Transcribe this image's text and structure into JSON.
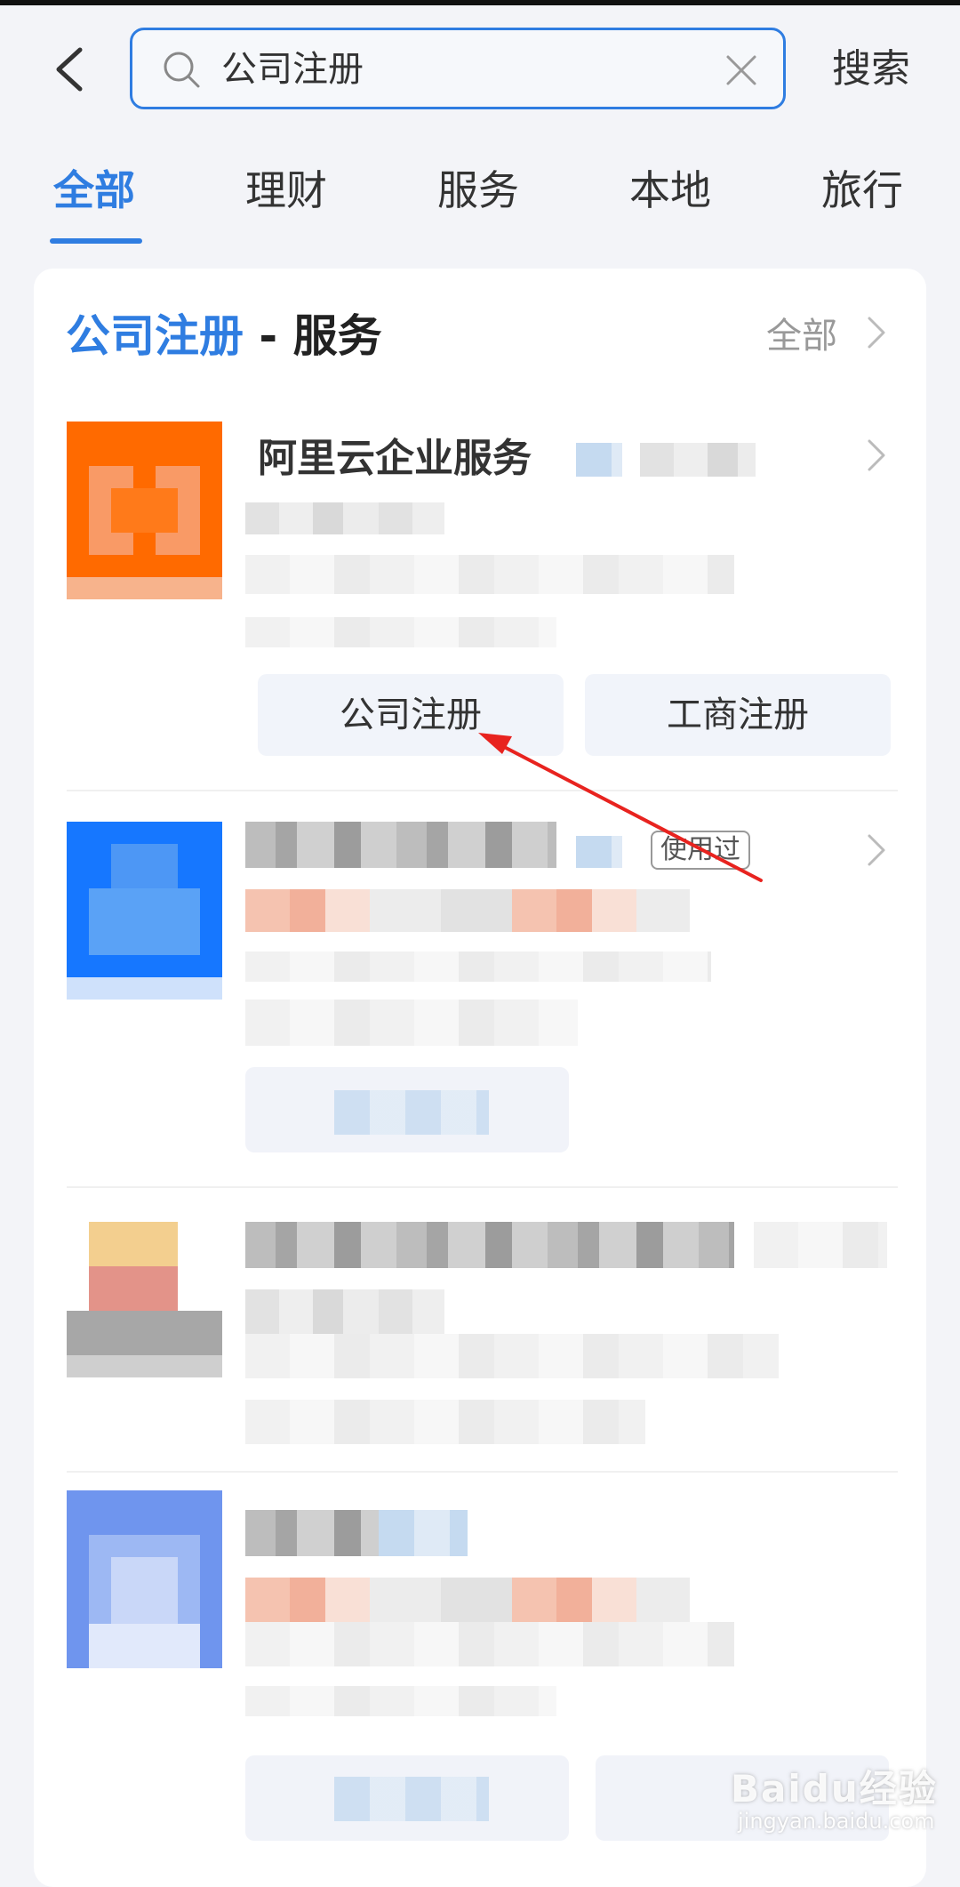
{
  "search": {
    "query": "公司注册",
    "button_label": "搜索"
  },
  "tabs": [
    {
      "label": "全部",
      "active": true
    },
    {
      "label": "理财"
    },
    {
      "label": "服务"
    },
    {
      "label": "本地"
    },
    {
      "label": "旅行"
    }
  ],
  "section": {
    "keyword": "公司注册",
    "suffix": " - 服务",
    "all_label": "全部"
  },
  "results": [
    {
      "name": "阿里云企业服务",
      "actions": [
        "公司注册",
        "工商注册"
      ]
    },
    {
      "badge": "使用过"
    }
  ],
  "watermark": {
    "brand": "Baidu经验",
    "url": "jingyan.baidu.com"
  },
  "colors": {
    "accent": "#2f7de1",
    "arrow": "#e8231f",
    "aliyun_orange": "#ff6a00"
  }
}
